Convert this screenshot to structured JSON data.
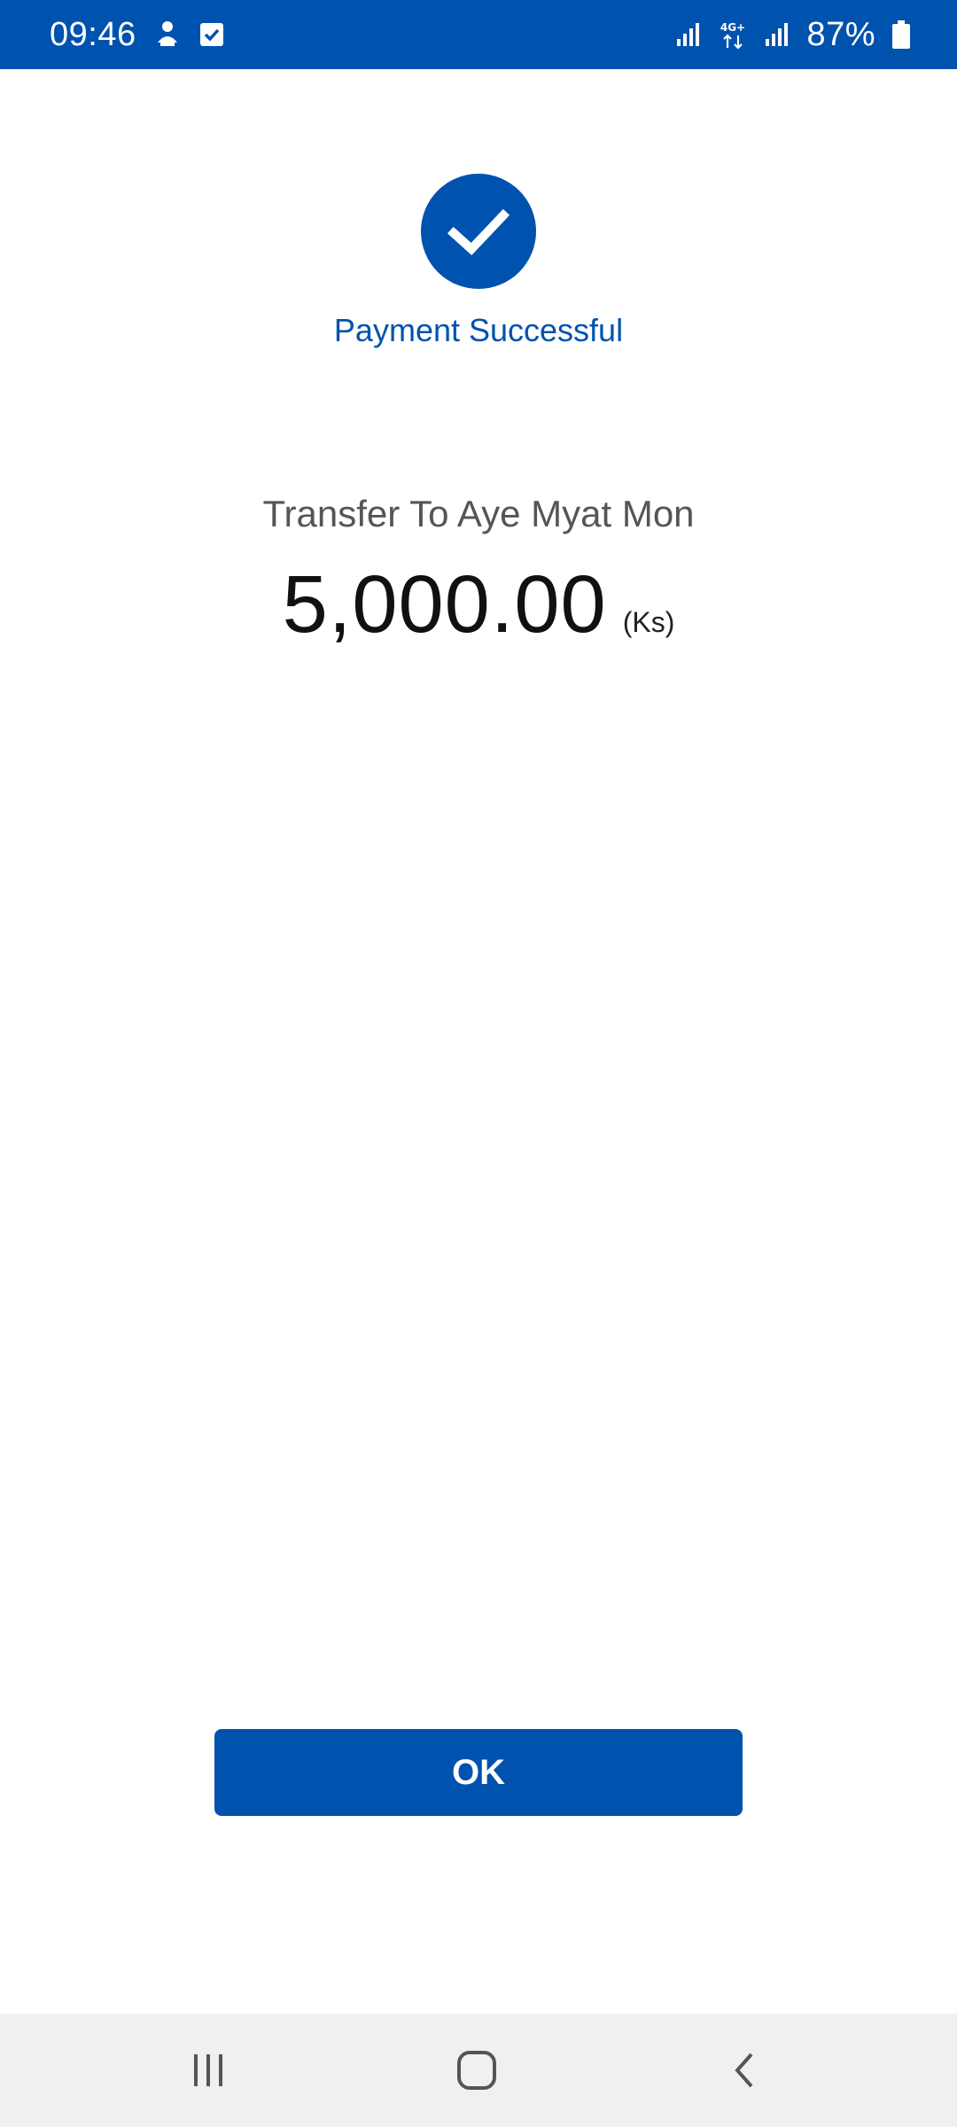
{
  "status_bar": {
    "time": "09:46",
    "battery_text": "87%",
    "icons": [
      "notification-person-icon",
      "checkbox-icon",
      "signal-icon",
      "4g-icon",
      "signal-icon",
      "battery-icon"
    ]
  },
  "result": {
    "status_title": "Payment Successful",
    "icon": "check-icon"
  },
  "transfer": {
    "label": "Transfer To Aye Myat Mon",
    "amount": "5,000.00",
    "currency": "(Ks)"
  },
  "actions": {
    "ok_label": "OK"
  },
  "navigation": {
    "icons": [
      "recent-apps-icon",
      "home-icon",
      "back-icon"
    ]
  },
  "colors": {
    "primary": "#0052AF",
    "nav_background": "#F0F0F0",
    "text_secondary": "#555555"
  }
}
